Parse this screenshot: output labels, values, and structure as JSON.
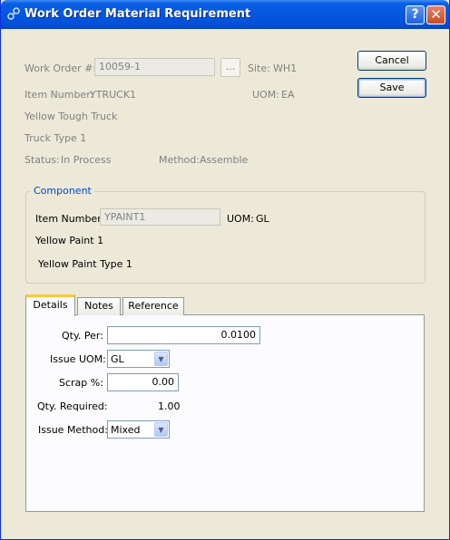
{
  "window": {
    "title": "Work Order Material Requirement",
    "help_label": "?",
    "close_label": "✕"
  },
  "header": {
    "work_order_label": "Work Order #:",
    "work_order_value": "10059-1",
    "browse_label": "...",
    "site_label": "Site:",
    "site_value": "WH1",
    "item_number_label": "Item Number:",
    "item_number_value": "YTRUCK1",
    "uom_label": "UOM:",
    "uom_value": "EA",
    "description1": "Yellow Tough Truck",
    "description2": "Truck Type 1",
    "status_label": "Status:",
    "status_value": "In Process",
    "method_label": "Method:",
    "method_value": "Assemble"
  },
  "buttons": {
    "cancel": "Cancel",
    "save": "Save"
  },
  "component": {
    "title": "Component",
    "item_number_label": "Item Number:",
    "item_number_value": "YPAINT1",
    "uom_label": "UOM:",
    "uom_value": "GL",
    "description1": "Yellow Paint 1",
    "description2": "Yellow Paint Type 1"
  },
  "tabs": [
    {
      "label": "Details",
      "active": true
    },
    {
      "label": "Notes",
      "active": false
    },
    {
      "label": "Reference",
      "active": false
    }
  ],
  "details": {
    "qty_per_label": "Qty. Per:",
    "qty_per_value": "0.0100",
    "issue_uom_label": "Issue UOM:",
    "issue_uom_value": "GL",
    "scrap_label": "Scrap %:",
    "scrap_value": "0.00",
    "qty_required_label": "Qty. Required:",
    "qty_required_value": "1.00",
    "issue_method_label": "Issue Method:",
    "issue_method_value": "Mixed"
  },
  "colors": {
    "titlebar": "#0457e0",
    "window_bg": "#ece9d8",
    "group_title": "#0046d5",
    "active_tab_accent": "#ffc83c"
  }
}
